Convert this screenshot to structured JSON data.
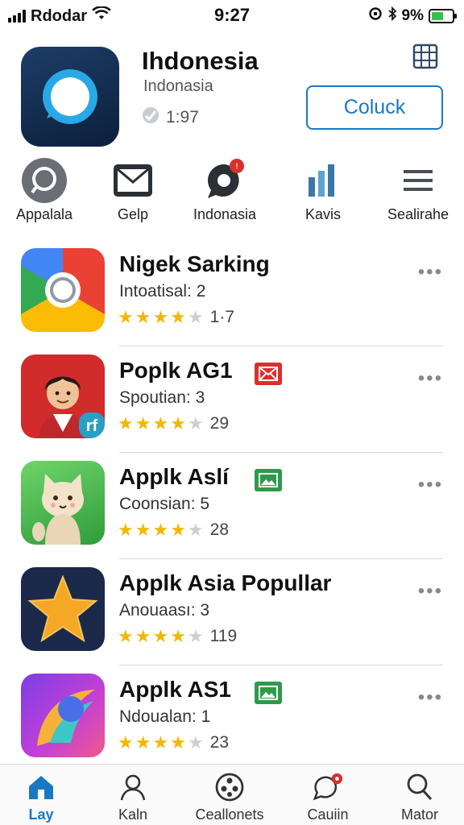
{
  "status_bar": {
    "carrier": "Rdodar",
    "time": "9:27",
    "battery_text": "9%",
    "battery_level": 0.6
  },
  "header": {
    "title": "Ihdonesia",
    "subtitle": "Indonasia",
    "rating": "1:97",
    "action_label": "Coluck"
  },
  "categories": [
    {
      "label": "Appalala",
      "icon": "search-chat-icon"
    },
    {
      "label": "Gelp",
      "icon": "mail-icon"
    },
    {
      "label": "Indonasia",
      "icon": "chat-bubble-icon"
    },
    {
      "label": "Kavis",
      "icon": "bar-chart-icon"
    },
    {
      "label": "Sealirahe",
      "icon": "menu-icon"
    }
  ],
  "apps": [
    {
      "name": "Nigek Sarking",
      "meta": "Intoatisal: 2",
      "rating": 4,
      "count": "1·7",
      "icon": "chrome-icon"
    },
    {
      "name": "Poplk AG1",
      "meta": "Spoutian: 3",
      "rating": 4,
      "count": "29",
      "icon": "person-avatar-icon",
      "badge": "red-mail-badge"
    },
    {
      "name": "Applk Aslí",
      "meta": "Coonsian: 5",
      "rating": 4,
      "count": "28",
      "icon": "cat-icon",
      "badge": "green-image-badge"
    },
    {
      "name": "Applk Asia  Popullar",
      "meta": "Anouaası: 3",
      "rating": 4,
      "count": "119",
      "icon": "star-icon"
    },
    {
      "name": "Applk AS1",
      "meta": "Ndoualan: 1",
      "rating": 4,
      "count": "23",
      "icon": "gradient-swoosh-icon",
      "badge": "green-image-badge"
    }
  ],
  "tabs": [
    {
      "label": "Lay",
      "icon": "home-icon",
      "active": true
    },
    {
      "label": "Kaln",
      "icon": "person-icon"
    },
    {
      "label": "Ceallonets",
      "icon": "film-reel-icon"
    },
    {
      "label": "Cauiin",
      "icon": "chat-bubble-icon"
    },
    {
      "label": "Mator",
      "icon": "search-icon"
    }
  ],
  "colors": {
    "accent": "#1a78c2",
    "star": "#f2b705",
    "badge_red": "#d9302c",
    "badge_green": "#2f9a4a"
  }
}
